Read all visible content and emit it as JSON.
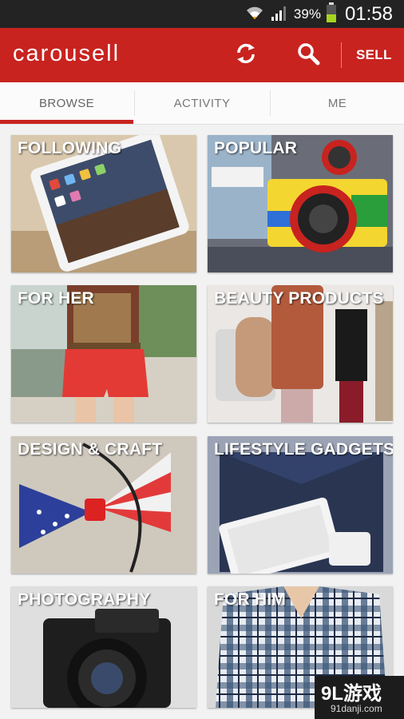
{
  "status_bar": {
    "battery": "39%",
    "time": "01:58",
    "icons": [
      "wifi-icon",
      "signal-icon",
      "battery-icon"
    ]
  },
  "app_bar": {
    "logo": "carousell",
    "sell_label": "SELL",
    "color": "#c8231f",
    "icons": [
      "refresh-icon",
      "search-icon"
    ]
  },
  "tabs": [
    {
      "label": "BROWSE",
      "active": true
    },
    {
      "label": "ACTIVITY",
      "active": false
    },
    {
      "label": "ME",
      "active": false
    }
  ],
  "categories": [
    {
      "label": "FOLLOWING"
    },
    {
      "label": "POPULAR"
    },
    {
      "label": "FOR HER"
    },
    {
      "label": "BEAUTY PRODUCTS"
    },
    {
      "label": "DESIGN & CRAFT"
    },
    {
      "label": "LIFESTYLE GADGETS"
    },
    {
      "label": "PHOTOGRAPHY"
    },
    {
      "label": "FOR HIM"
    }
  ],
  "watermark": {
    "title": "9L游戏",
    "subtitle": "91danji.com"
  }
}
